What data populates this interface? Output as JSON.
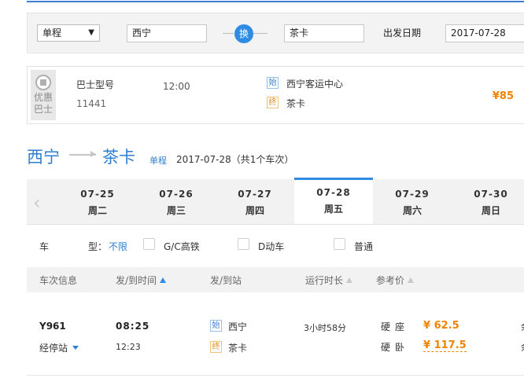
{
  "search": {
    "trip_type": "单程",
    "from_city": "西宁",
    "swap_label": "换",
    "to_city": "茶卡",
    "date_label": "出发日期",
    "date_value": "2017-07-28"
  },
  "bus": {
    "badge_line1": "优惠",
    "badge_line2": "巴士",
    "model_label": "巴士型号",
    "model_number": "11441",
    "time": "12:00",
    "start_tag": "始",
    "start_station": "西宁客运中心",
    "end_tag": "终",
    "end_station": "茶卡",
    "price": "¥85"
  },
  "route": {
    "from": "西宁",
    "to": "茶卡",
    "trip_type": "单程",
    "summary": "2017-07-28（共1个车次）"
  },
  "date_tabs": [
    {
      "date": "07-25",
      "weekday": "周二",
      "active": false
    },
    {
      "date": "07-26",
      "weekday": "周三",
      "active": false
    },
    {
      "date": "07-27",
      "weekday": "周四",
      "active": false
    },
    {
      "date": "07-28",
      "weekday": "周五",
      "active": true
    },
    {
      "date": "07-29",
      "weekday": "周六",
      "active": false
    },
    {
      "date": "07-30",
      "weekday": "周日",
      "active": false
    }
  ],
  "filters": {
    "label_a": "车",
    "label_b": "型：",
    "active": "不限",
    "option_gc": "G/C高铁",
    "option_d": "D动车",
    "option_normal": "普通"
  },
  "table_headers": {
    "train_info": "车次信息",
    "dep_arr_time": "发/到时间",
    "dep_arr_station": "发/到站",
    "duration": "运行时长",
    "ref_price": "参考价"
  },
  "train": {
    "number": "Y961",
    "stops_label": "经停站",
    "depart_time": "08:25",
    "arrive_time": "12:23",
    "start_tag": "始",
    "depart_station": "西宁",
    "end_tag": "终",
    "arrive_station": "茶卡",
    "duration": "3小时58分",
    "seats": [
      {
        "name": "硬座",
        "price": "¥ 62.5"
      },
      {
        "name": "硬卧",
        "price": "¥ 117.5"
      }
    ],
    "cut_edge_chars": [
      "余",
      "余"
    ]
  },
  "colors": {
    "accent_blue": "#2e8ce4",
    "price_orange": "#f08300",
    "route_blue": "#2e7fd2"
  }
}
